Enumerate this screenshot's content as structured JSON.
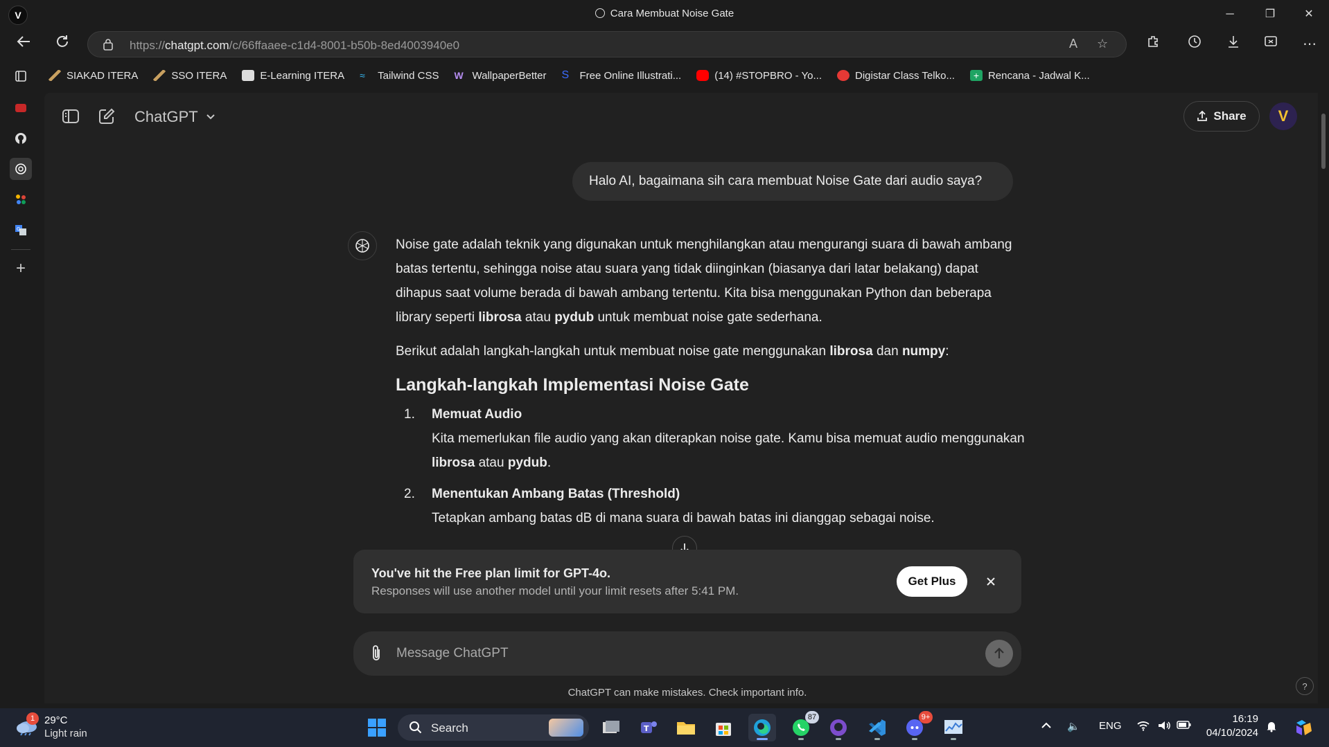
{
  "window": {
    "tab_title": "Cara Membuat Noise Gate",
    "minimize": "─",
    "restore": "❐",
    "close": "✕"
  },
  "nav": {
    "url_prefix": "https://",
    "url_host": "chatgpt.com",
    "url_path": "/c/66ffaaee-c1d4-8001-b50b-8ed4003940e0"
  },
  "bookmarks": [
    {
      "label": "SIAKAD ITERA",
      "color": "#c8a060"
    },
    {
      "label": "SSO ITERA",
      "color": "#c8a060"
    },
    {
      "label": "E-Learning ITERA",
      "color": "#dddddd"
    },
    {
      "label": "Tailwind CSS",
      "color": "#38bdf8"
    },
    {
      "label": "WallpaperBetter",
      "color": "#b48cf0"
    },
    {
      "label": "Free Online Illustrati...",
      "color": "#3b6cff"
    },
    {
      "label": "(14) #STOPBRO - Yo...",
      "color": "#ff0000"
    },
    {
      "label": "Digistar Class Telko...",
      "color": "#e53935"
    },
    {
      "label": "Rencana - Jadwal K...",
      "color": "#1fa463"
    }
  ],
  "chat": {
    "model": "ChatGPT",
    "share": "Share",
    "user_message": "Halo AI, bagaimana sih cara membuat Noise Gate dari audio saya?",
    "answer": {
      "p1_a": "Noise gate adalah teknik yang digunakan untuk menghilangkan atau mengurangi suara di bawah ambang batas tertentu, sehingga noise atau suara yang tidak diinginkan (biasanya dari latar belakang) dapat dihapus saat volume berada di bawah ambang tertentu. Kita bisa menggunakan Python dan beberapa library seperti ",
      "p1_b": "librosa",
      "p1_c": " atau ",
      "p1_d": "pydub",
      "p1_e": " untuk membuat noise gate sederhana.",
      "p2_a": "Berikut adalah langkah-langkah untuk membuat noise gate menggunakan ",
      "p2_b": "librosa",
      "p2_c": " dan ",
      "p2_d": "numpy",
      "p2_e": ":",
      "heading": "Langkah-langkah Implementasi Noise Gate",
      "steps": [
        {
          "num": "1.",
          "title": "Memuat Audio",
          "text_a": "Kita memerlukan file audio yang akan diterapkan noise gate. Kamu bisa memuat audio menggunakan ",
          "text_b": "librosa",
          "text_c": " atau ",
          "text_d": "pydub",
          "text_e": "."
        },
        {
          "num": "2.",
          "title": "Menentukan Ambang Batas (Threshold)",
          "text_a": "Tetapkan ambang batas dB di mana suara di bawah batas ini dianggap sebagai noise."
        }
      ]
    },
    "limit_title": "You've hit the Free plan limit for GPT-4o.",
    "limit_text": "Responses will use another model until your limit resets after 5:41 PM.",
    "get_plus": "Get Plus",
    "composer_placeholder": "Message ChatGPT",
    "disclaimer": "ChatGPT can make mistakes. Check important info.",
    "help": "?"
  },
  "taskbar": {
    "weather_temp": "29°C",
    "weather_cond": "Light rain",
    "weather_badge": "1",
    "search_label": "Search",
    "whatsapp_badge": "87",
    "discord_badge": "9+",
    "lang": "ENG",
    "time": "16:19",
    "date": "04/10/2024"
  }
}
